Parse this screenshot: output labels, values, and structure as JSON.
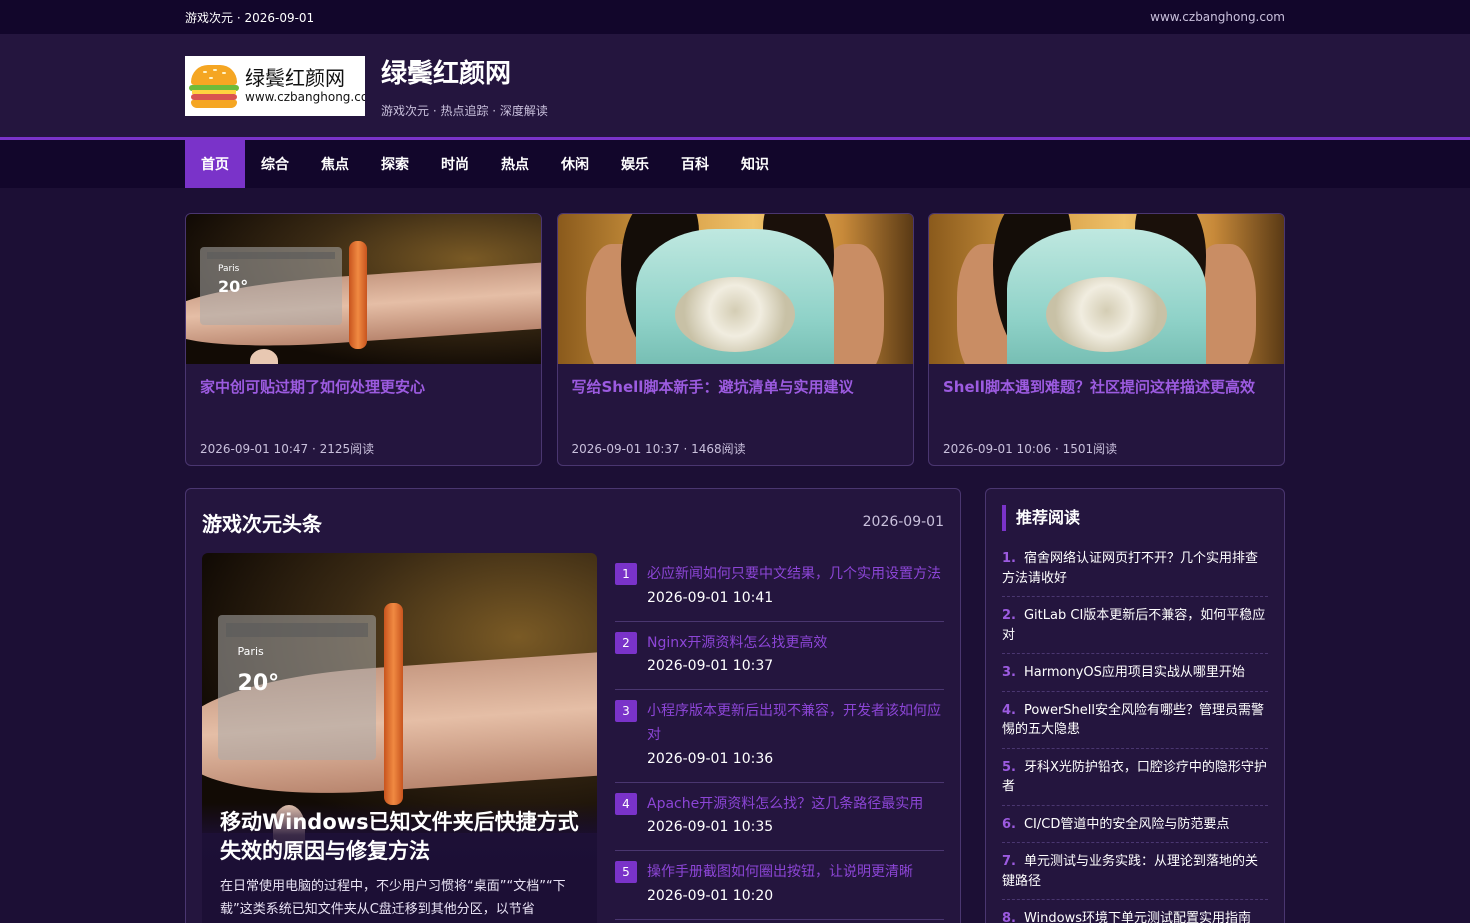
{
  "topbar": {
    "left": "游戏次元 · 2026-09-01",
    "right": "www.czbanghong.com"
  },
  "header": {
    "logo_line1": "绿鬓红颜网",
    "logo_line2": "www.czbanghong.com",
    "site_title": "绿鬓红颜网",
    "tagline": "游戏次元 · 热点追踪 · 深度解读"
  },
  "nav": [
    "首页",
    "综合",
    "焦点",
    "探索",
    "时尚",
    "热点",
    "休闲",
    "娱乐",
    "百科",
    "知识"
  ],
  "cards": [
    {
      "title": "家中创可贴过期了如何处理更安心",
      "meta": "2026-09-01 10:47 · 2125阅读",
      "image": "wrist-display"
    },
    {
      "title": "写给Shell脚本新手：避坑清单与实用建议",
      "meta": "2026-09-01 10:37 · 1468阅读",
      "image": "dress-necklace"
    },
    {
      "title": "Shell脚本遇到难题？社区提问这样描述更高效",
      "meta": "2026-09-01 10:06 · 1501阅读",
      "image": "dress-necklace"
    }
  ],
  "image_text": {
    "city": "Paris",
    "temp": "20°"
  },
  "main": {
    "title": "游戏次元头条",
    "date": "2026-09-01",
    "hero": {
      "title": "移动Windows已知文件夹后快捷方式失效的原因与修复方法",
      "excerpt": "在日常使用电脑的过程中，不少用户习惯将“桌面”“文档”“下载”这类系统已知文件夹从C盘迁移到其他分区，以节省"
    },
    "list": [
      {
        "num": "1",
        "title": "必应新闻如何只要中文结果，几个实用设置方法",
        "time": "2026-09-01 10:41"
      },
      {
        "num": "2",
        "title": "Nginx开源资料怎么找更高效",
        "time": "2026-09-01 10:37"
      },
      {
        "num": "3",
        "title": "小程序版本更新后出现不兼容，开发者该如何应对",
        "time": "2026-09-01 10:36"
      },
      {
        "num": "4",
        "title": "Apache开源资料怎么找？这几条路径最实用",
        "time": "2026-09-01 10:35"
      },
      {
        "num": "5",
        "title": "操作手册截图如何圈出按钮，让说明更清晰",
        "time": "2026-09-01 10:20"
      }
    ]
  },
  "sidebar": {
    "title": "推荐阅读",
    "items": [
      {
        "idx": "1.",
        "text": "宿舍网络认证网页打不开？几个实用排查方法请收好"
      },
      {
        "idx": "2.",
        "text": "GitLab CI版本更新后不兼容，如何平稳应对"
      },
      {
        "idx": "3.",
        "text": "HarmonyOS应用项目实战从哪里开始"
      },
      {
        "idx": "4.",
        "text": "PowerShell安全风险有哪些？管理员需警惕的五大隐患"
      },
      {
        "idx": "5.",
        "text": "牙科X光防护铅衣，口腔诊疗中的隐形守护者"
      },
      {
        "idx": "6.",
        "text": "CI/CD管道中的安全风险与防范要点"
      },
      {
        "idx": "7.",
        "text": "单元测试与业务实践：从理论到落地的关键路径"
      },
      {
        "idx": "8.",
        "text": "Windows环境下单元测试配置实用指南"
      }
    ]
  },
  "colors": {
    "accent": "#7a33c9",
    "background": "#1c0f35",
    "panel": "#24153e",
    "link": "#8c45d6"
  }
}
